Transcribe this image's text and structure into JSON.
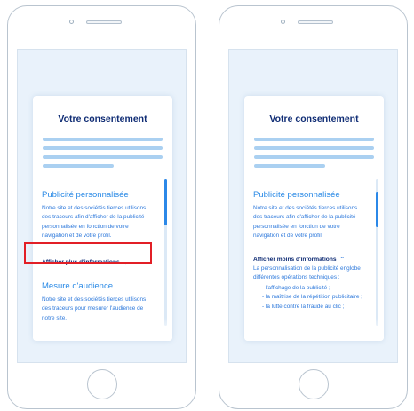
{
  "left": {
    "title": "Votre consentement",
    "section1_title": "Publicité personnalisée",
    "section1_lines": [
      "Notre site et des sociétés tierces utilisons",
      "des traceurs afin d'afficher de la publicité",
      "personnalisée en fonction de votre",
      "navigation et de votre profil."
    ],
    "more_link": "Afficher plus d'informations",
    "section2_title": "Mesure d'audience",
    "section2_lines": [
      "Notre site et des sociétés tierces utilisons",
      "des traceurs pour mesurer l'audience de",
      "notre site."
    ]
  },
  "right": {
    "title": "Votre consentement",
    "section1_title": "Publicité personnalisée",
    "section1_lines": [
      "Notre site et des sociétés tierces utilisons",
      "des traceurs afin d'afficher de la publicité",
      "personnalisée en fonction de votre",
      "navigation et de votre profil."
    ],
    "less_link": "Afficher moins d'informations",
    "details_lines": [
      "La personnalisation de la publicité englobe",
      "différentes opérations techniques :"
    ],
    "bullets": [
      "- l'affichage de la publicité ;",
      "- la maîtrise de la répétition publicitaire ;",
      "- la lutte contre la fraude au clic ;"
    ]
  },
  "colors": {
    "title": "#0f2c74",
    "accent": "#2c78db",
    "highlight": "#e21f26",
    "screen_bg": "#e9f2fb"
  },
  "icons": {
    "expand": "chevron-down-icon",
    "collapse": "chevron-up-icon"
  }
}
